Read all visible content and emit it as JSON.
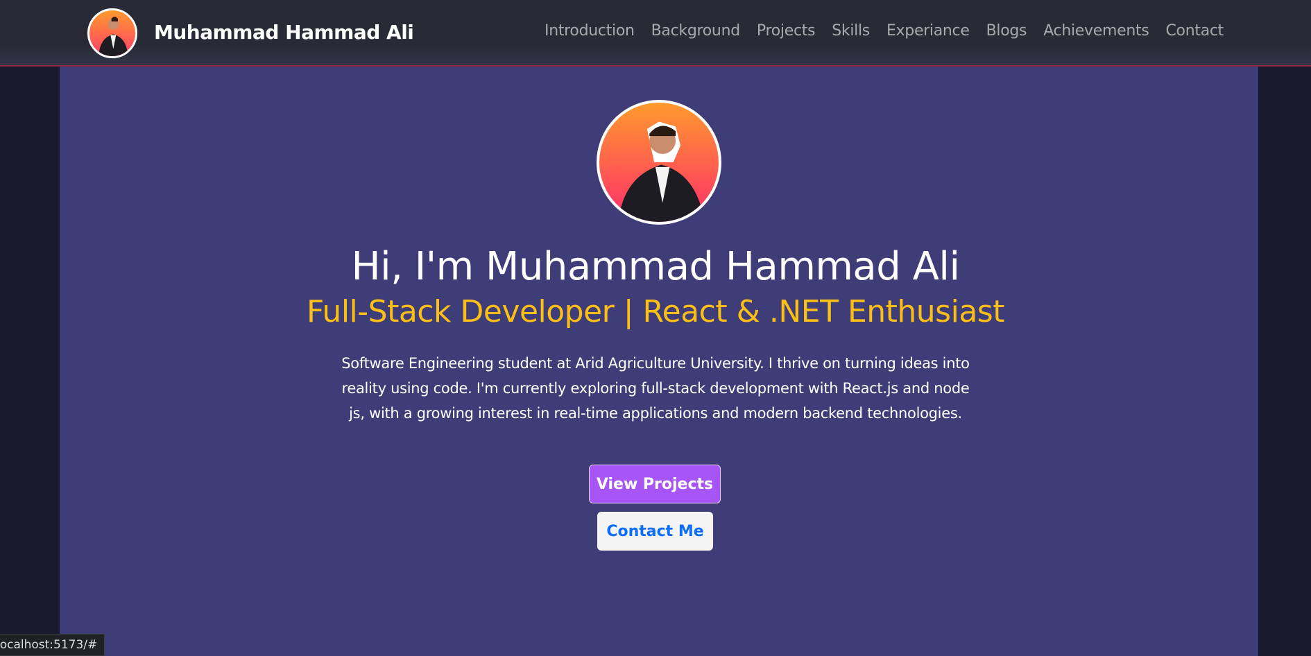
{
  "header": {
    "brand": "Muhammad Hammad Ali",
    "nav": [
      "Introduction",
      "Background",
      "Projects",
      "Skills",
      "Experiance",
      "Blogs",
      "Achievements",
      "Contact"
    ]
  },
  "hero": {
    "heading": "Hi, I'm Muhammad Hammad Ali",
    "subtitle": "Full-Stack Developer | React & .NET Enthusiast",
    "bio": "Software Engineering student at Arid Agriculture University. I thrive on turning ideas into reality using code. I'm currently exploring full-stack development with React.js and node js, with a growing interest in real-time applications and modern backend technologies.",
    "view_projects": "View Projects",
    "contact_me": "Contact Me"
  },
  "status_bar": {
    "url": "localhost:5173/#"
  },
  "colors": {
    "accent": "#a855f7",
    "subtitle": "#fbbf16",
    "link": "#0d6efd",
    "panel": "#3e3d78"
  }
}
